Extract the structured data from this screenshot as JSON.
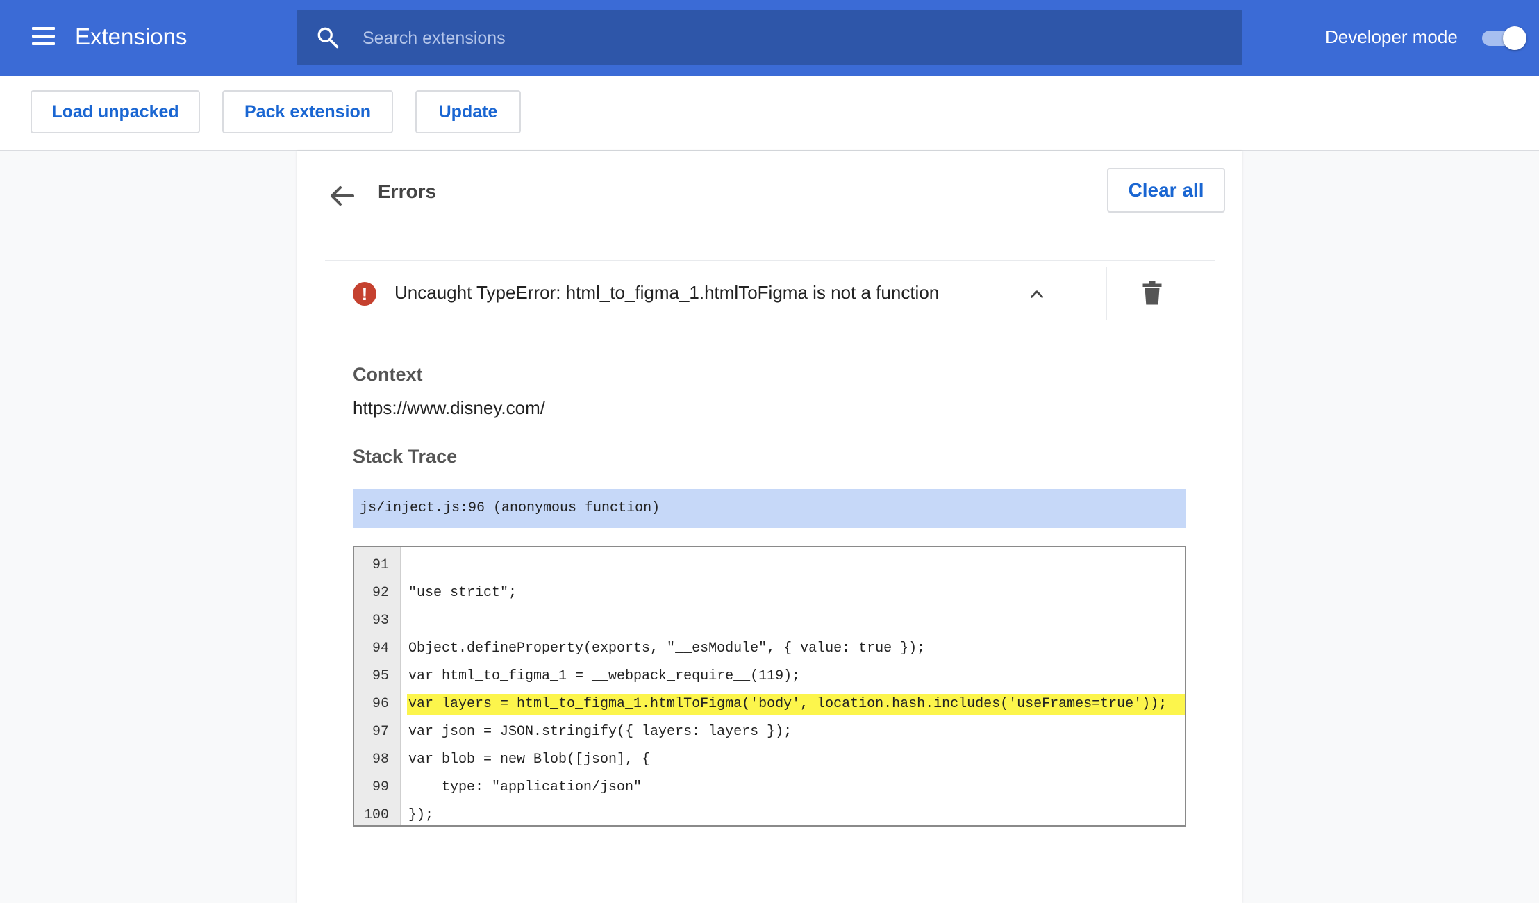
{
  "header": {
    "title": "Extensions",
    "search_placeholder": "Search extensions",
    "developer_mode_label": "Developer mode",
    "developer_mode_on": true,
    "brand_color": "#3b6bd6"
  },
  "toolbar": {
    "load_unpacked": "Load unpacked",
    "pack_extension": "Pack extension",
    "update": "Update"
  },
  "errors_page": {
    "title": "Errors",
    "clear_all": "Clear all",
    "error": {
      "icon": "error-icon",
      "message": "Uncaught TypeError: html_to_figma_1.htmlToFigma is not a function"
    },
    "context_heading": "Context",
    "context_url": "https://www.disney.com/",
    "stack_trace_heading": "Stack Trace",
    "stack_frame": "js/inject.js:96 (anonymous function)",
    "code_lines": [
      {
        "n": "91",
        "text": ""
      },
      {
        "n": "92",
        "text": "\"use strict\";"
      },
      {
        "n": "93",
        "text": ""
      },
      {
        "n": "94",
        "text": "Object.defineProperty(exports, \"__esModule\", { value: true });"
      },
      {
        "n": "95",
        "text": "var html_to_figma_1 = __webpack_require__(119);"
      },
      {
        "n": "96",
        "text": "var layers = html_to_figma_1.htmlToFigma('body', location.hash.includes('useFrames=true'));",
        "highlight": true
      },
      {
        "n": "97",
        "text": "var json = JSON.stringify({ layers: layers });"
      },
      {
        "n": "98",
        "text": "var blob = new Blob([json], {"
      },
      {
        "n": "99",
        "text": "    type: \"application/json\""
      },
      {
        "n": "100",
        "text": "});"
      }
    ]
  }
}
